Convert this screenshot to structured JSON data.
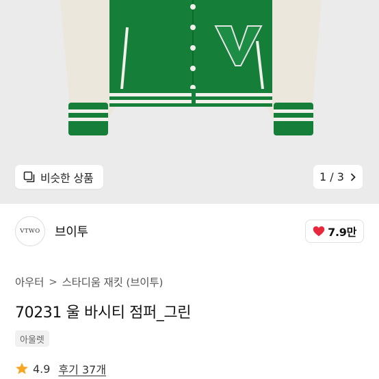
{
  "hero": {
    "similar_label": "비슷한 상품",
    "pager_text": "1 / 3",
    "colors": {
      "background": "#ebebeb",
      "jacket_green": "#157f3a",
      "sleeve_cream": "#ece7dc"
    }
  },
  "brand": {
    "logo_text": "VTWO",
    "name": "브이투",
    "likes": "7.9만"
  },
  "breadcrumb": {
    "category": "아우터",
    "separator": ">",
    "subcategory": "스타디움 재킷 (브이투)"
  },
  "product": {
    "title": "70231 울 바시티 점퍼_그린",
    "tag": "아울렛"
  },
  "rating": {
    "score": "4.9",
    "reviews": "후기 37개"
  },
  "icons": {
    "similar": "similar-items-icon",
    "pager": "chevron-right-icon",
    "like": "heart-icon",
    "rating": "star-icon"
  },
  "accent_colors": {
    "heart": "#e8283c",
    "star": "#f5a623"
  }
}
